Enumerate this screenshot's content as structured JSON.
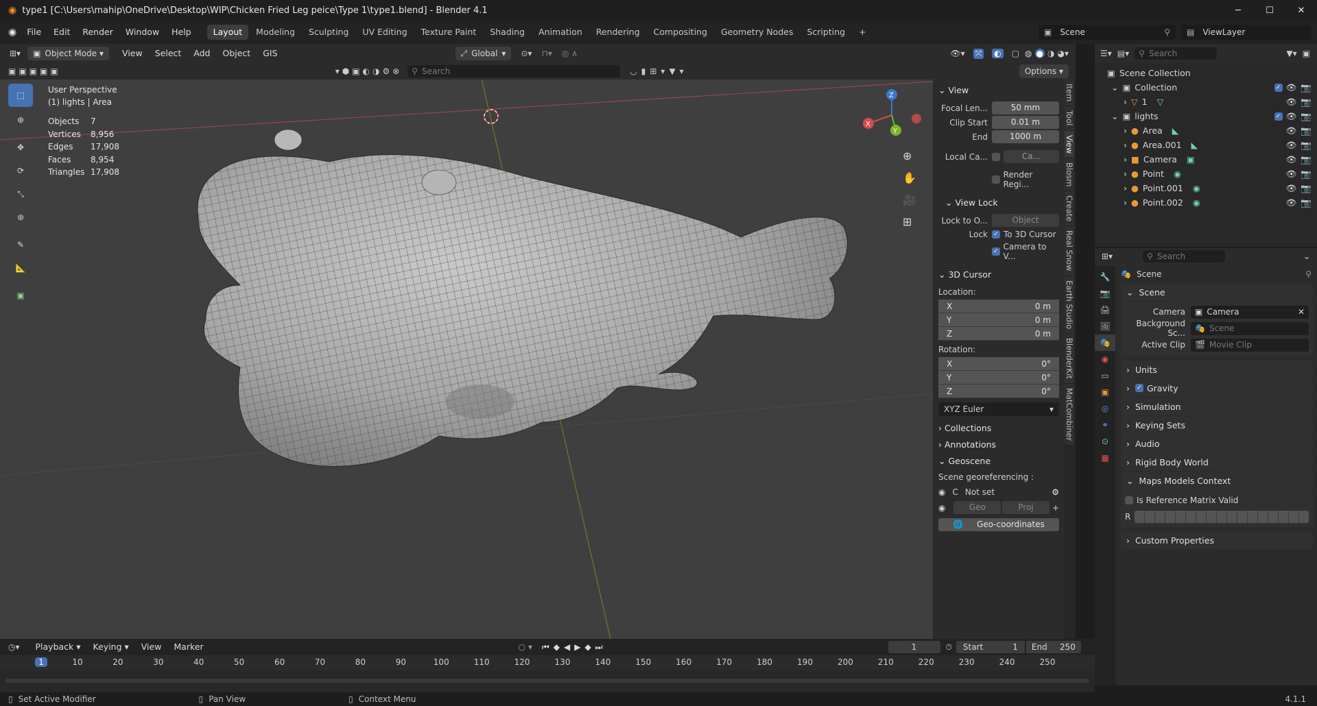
{
  "window": {
    "title": "type1 [C:\\Users\\mahip\\OneDrive\\Desktop\\WIP\\Chicken Fried Leg peice\\Type 1\\type1.blend] - Blender 4.1",
    "controls": [
      "─",
      "☐",
      "✕"
    ]
  },
  "menu": {
    "items": [
      "File",
      "Edit",
      "Render",
      "Window",
      "Help"
    ]
  },
  "workspaces": [
    "Layout",
    "Modeling",
    "Sculpting",
    "UV Editing",
    "Texture Paint",
    "Shading",
    "Animation",
    "Rendering",
    "Compositing",
    "Geometry Nodes",
    "Scripting",
    "+"
  ],
  "scene_field": "Scene",
  "viewlayer_field": "ViewLayer",
  "viewport_header": {
    "mode": "Object Mode",
    "menus": [
      "View",
      "Select",
      "Add",
      "Object",
      "GIS"
    ],
    "orientation": "Global",
    "search_placeholder": "Search",
    "options": "Options"
  },
  "viewport": {
    "perspective": "User Perspective",
    "context_obj": "(1) lights | Area",
    "stats": [
      {
        "label": "Objects",
        "value": "7"
      },
      {
        "label": "Vertices",
        "value": "8,956"
      },
      {
        "label": "Edges",
        "value": "17,908"
      },
      {
        "label": "Faces",
        "value": "8,954"
      },
      {
        "label": "Triangles",
        "value": "17,908"
      }
    ],
    "gizmo": {
      "x": "X",
      "y": "Y",
      "z": "Z"
    }
  },
  "npanel": {
    "view_title": "View",
    "focal_label": "Focal Len...",
    "focal_value": "50 mm",
    "clip_start_label": "Clip Start",
    "clip_start_value": "0.01 m",
    "clip_end_label": "End",
    "clip_end_value": "1000 m",
    "local_cam_label": "Local Ca...",
    "local_cam_value": "Ca...",
    "render_region": "Render Regi...",
    "view_lock_title": "View Lock",
    "lock_to_label": "Lock to O...",
    "lock_to_placeholder": "Object",
    "lock_label": "Lock",
    "lock_3d_cursor": "To 3D Cursor",
    "lock_camera": "Camera to V...",
    "cursor_title": "3D Cursor",
    "location_label": "Location:",
    "rotation_label": "Rotation:",
    "loc": [
      {
        "axis": "X",
        "val": "0 m"
      },
      {
        "axis": "Y",
        "val": "0 m"
      },
      {
        "axis": "Z",
        "val": "0 m"
      }
    ],
    "rot": [
      {
        "axis": "X",
        "val": "0°"
      },
      {
        "axis": "Y",
        "val": "0°"
      },
      {
        "axis": "Z",
        "val": "0°"
      }
    ],
    "rot_mode": "XYZ Euler",
    "collections": "Collections",
    "annotations": "Annotations",
    "geoscene": "Geoscene",
    "georef_label": "Scene georeferencing :",
    "crs_c": "C",
    "crs_value": "Not set",
    "geo_btn": "Geo",
    "proj_btn": "Proj",
    "geocoords_btn": "Geo-coordinates",
    "tabs": [
      "Item",
      "Tool",
      "View",
      "Blosm",
      "Create",
      "Real Snow",
      "Earth Studio",
      "BlenderKit",
      "MatCombiner"
    ]
  },
  "outliner": {
    "search_placeholder": "Search",
    "rows": [
      {
        "label": "Scene Collection",
        "indent": 0,
        "icon": "collection"
      },
      {
        "label": "Collection",
        "indent": 1,
        "icon": "collection",
        "check": true
      },
      {
        "label": "1",
        "indent": 2,
        "icon": "mesh"
      },
      {
        "label": "lights",
        "indent": 1,
        "icon": "collection",
        "check": true
      },
      {
        "label": "Area",
        "indent": 2,
        "icon": "light"
      },
      {
        "label": "Area.001",
        "indent": 2,
        "icon": "light"
      },
      {
        "label": "Camera",
        "indent": 2,
        "icon": "camera"
      },
      {
        "label": "Point",
        "indent": 2,
        "icon": "light"
      },
      {
        "label": "Point.001",
        "indent": 2,
        "icon": "light"
      },
      {
        "label": "Point.002",
        "indent": 2,
        "icon": "light"
      }
    ]
  },
  "properties": {
    "search_placeholder": "Search",
    "breadcrumb": "Scene",
    "scene_section": "Scene",
    "camera_label": "Camera",
    "camera_value": "Camera",
    "bg_label": "Background Sc...",
    "bg_placeholder": "Scene",
    "clip_label": "Active Clip",
    "clip_placeholder": "Movie Clip",
    "sections": [
      "Units",
      "Gravity",
      "Simulation",
      "Keying Sets",
      "Audio",
      "Rigid Body World",
      "Maps Models Context"
    ],
    "ref_matrix": "Is Reference Matrix Valid",
    "r_label": "R",
    "custom_props": "Custom Properties"
  },
  "timeline": {
    "menus": [
      "Playback",
      "Keying",
      "View",
      "Marker"
    ],
    "current_frame": "1",
    "start_label": "Start",
    "start_value": "1",
    "end_label": "End",
    "end_value": "250",
    "ticks": [
      "1",
      "10",
      "20",
      "30",
      "40",
      "50",
      "60",
      "70",
      "80",
      "90",
      "100",
      "110",
      "120",
      "130",
      "140",
      "150",
      "160",
      "170",
      "180",
      "190",
      "200",
      "210",
      "220",
      "230",
      "240",
      "250"
    ]
  },
  "statusbar": {
    "left": "Set Active Modifier",
    "mid": "Pan View",
    "right": "Context Menu",
    "version": "4.1.1"
  }
}
